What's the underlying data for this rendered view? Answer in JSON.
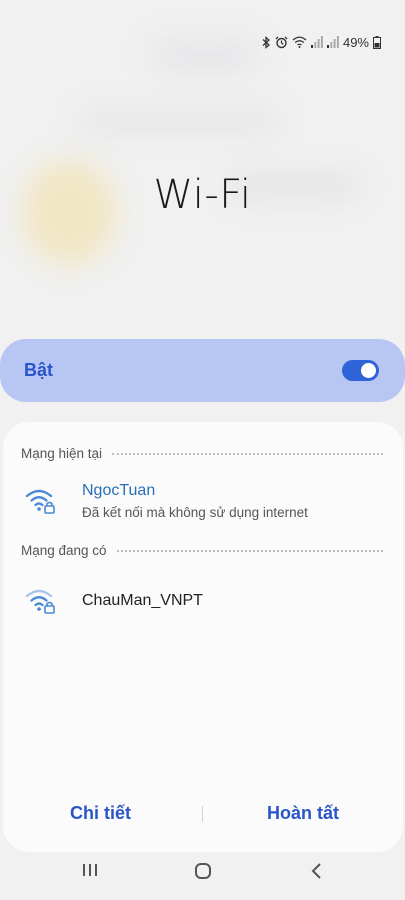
{
  "status_bar": {
    "battery_text": "49%"
  },
  "dialog": {
    "title": "Wi-Fi"
  },
  "toggle": {
    "label": "Bật",
    "state": "on"
  },
  "current_section": {
    "heading": "Mạng hiện tại"
  },
  "current_network": {
    "name": "NgocTuan",
    "status": "Đã kết nối mà không sử dụng internet",
    "icon": "wifi-lock-icon"
  },
  "available_section": {
    "heading": "Mạng đang có"
  },
  "available_networks": [
    {
      "name": "ChauMan_VNPT",
      "icon": "wifi-lock-icon"
    }
  ],
  "footer": {
    "details_label": "Chi tiết",
    "done_label": "Hoàn tất"
  },
  "colors": {
    "accent": "#2a55c8",
    "toggle_card": "#b7c6f3",
    "connected_name": "#2a6fb8"
  }
}
